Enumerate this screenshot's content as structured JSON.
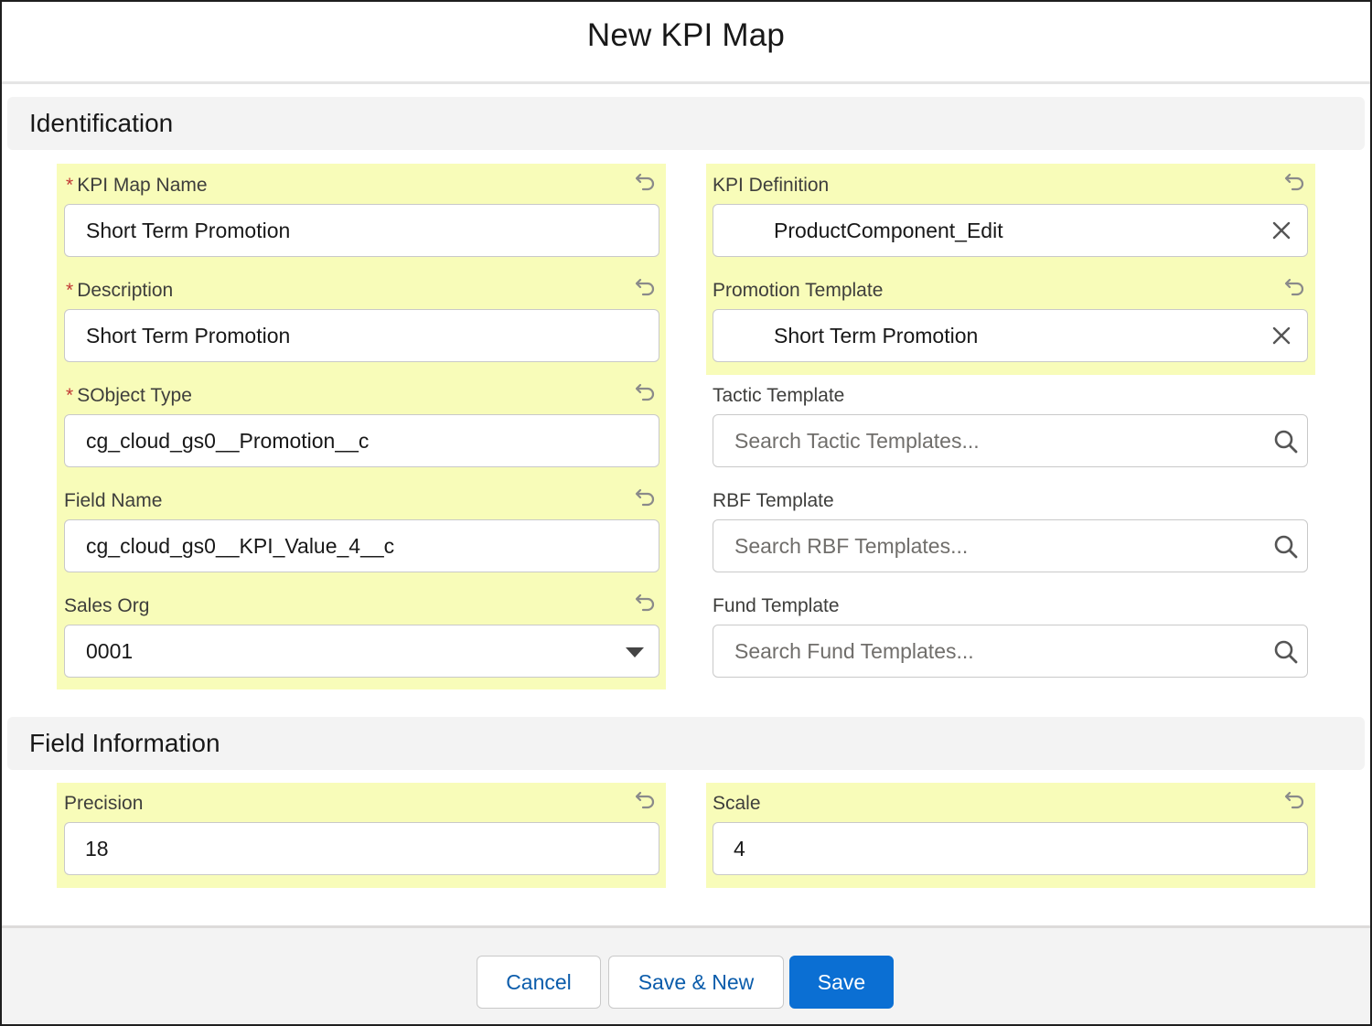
{
  "modal": {
    "title": "New KPI Map"
  },
  "sections": {
    "identification": "Identification",
    "field_information": "Field Information"
  },
  "fields": {
    "kpi_map_name": {
      "label": "KPI Map Name",
      "required": true,
      "value": "Short Term Promotion"
    },
    "description": {
      "label": "Description",
      "required": true,
      "value": "Short Term Promotion"
    },
    "sobject_type": {
      "label": "SObject Type",
      "required": true,
      "value": "cg_cloud_gs0__Promotion__c"
    },
    "field_name": {
      "label": "Field Name",
      "required": false,
      "value": "cg_cloud_gs0__KPI_Value_4__c"
    },
    "sales_org": {
      "label": "Sales Org",
      "required": false,
      "value": "0001"
    },
    "kpi_definition": {
      "label": "KPI Definition",
      "value": "ProductComponent_Edit"
    },
    "promotion_template": {
      "label": "Promotion Template",
      "value": "Short Term Promotion"
    },
    "tactic_template": {
      "label": "Tactic Template",
      "placeholder": "Search Tactic Templates..."
    },
    "rbf_template": {
      "label": "RBF Template",
      "placeholder": "Search RBF Templates..."
    },
    "fund_template": {
      "label": "Fund Template",
      "placeholder": "Search Fund Templates..."
    },
    "precision": {
      "label": "Precision",
      "value": "18"
    },
    "scale": {
      "label": "Scale",
      "value": "4"
    }
  },
  "required_marker": "*",
  "footer": {
    "cancel_label": "Cancel",
    "save_new_label": "Save & New",
    "save_label": "Save"
  },
  "colors": {
    "highlight": "#f8fcb9",
    "brand": "#0b6fd3",
    "required": "#c23934",
    "section_bg": "#f3f3f3"
  },
  "icons": [
    "undo-icon",
    "clear-icon",
    "search-icon",
    "dropdown-caret-icon"
  ]
}
